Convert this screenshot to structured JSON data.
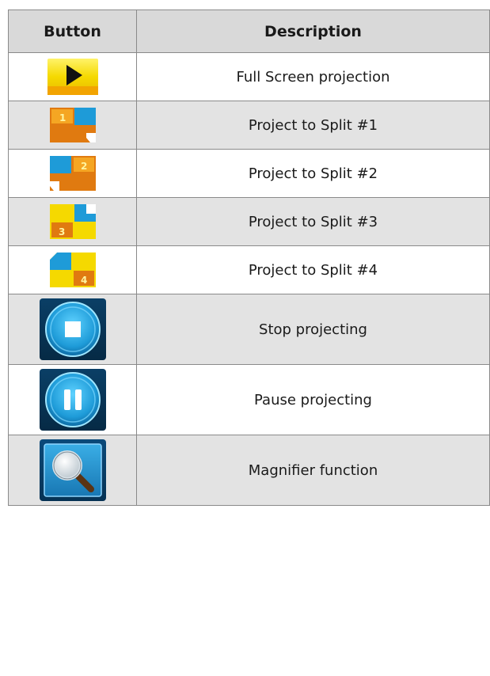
{
  "table": {
    "headers": {
      "button": "Button",
      "description": "Description"
    },
    "rows": [
      {
        "icon": "full-screen-play-icon",
        "description": "Full Screen projection"
      },
      {
        "icon": "split-1-icon",
        "description": "Project to Split #1",
        "split_number": "1"
      },
      {
        "icon": "split-2-icon",
        "description": "Project to Split #2",
        "split_number": "2"
      },
      {
        "icon": "split-3-icon",
        "description": "Project to Split #3",
        "split_number": "3"
      },
      {
        "icon": "split-4-icon",
        "description": "Project to Split #4",
        "split_number": "4"
      },
      {
        "icon": "stop-icon",
        "description": "Stop projecting"
      },
      {
        "icon": "pause-icon",
        "description": "Pause projecting"
      },
      {
        "icon": "magnifier-icon",
        "description": "Magnifier function"
      }
    ]
  },
  "colors": {
    "header_bg": "#d9d9d9",
    "shade_row_bg": "#e3e3e3",
    "border": "#8a8a8a",
    "icon_yellow": "#f5d900",
    "icon_orange": "#e07a10",
    "icon_blue": "#1e9bd8"
  }
}
